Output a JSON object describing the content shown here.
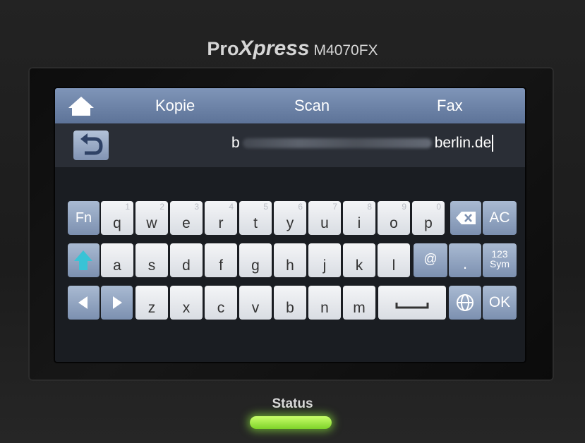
{
  "device": {
    "brand_pro": "Pro",
    "brand_x": "Xpress",
    "model": "M4070FX"
  },
  "topbar": {
    "home_icon": "home-icon",
    "tabs": [
      "Kopie",
      "Scan",
      "Fax"
    ]
  },
  "input": {
    "back_icon": "back-arrow-icon",
    "prefix": "b",
    "suffix": "berlin.de"
  },
  "keyboard": {
    "row1": [
      {
        "label": "q",
        "sub": "1"
      },
      {
        "label": "w",
        "sub": "2"
      },
      {
        "label": "e",
        "sub": "3"
      },
      {
        "label": "r",
        "sub": "4"
      },
      {
        "label": "t",
        "sub": "5"
      },
      {
        "label": "y",
        "sub": "6"
      },
      {
        "label": "u",
        "sub": "7"
      },
      {
        "label": "i",
        "sub": "8"
      },
      {
        "label": "o",
        "sub": "9"
      },
      {
        "label": "p",
        "sub": "0"
      }
    ],
    "row2": [
      "a",
      "s",
      "d",
      "f",
      "g",
      "h",
      "j",
      "k",
      "l"
    ],
    "row3": [
      "z",
      "x",
      "c",
      "v",
      "b",
      "n",
      "m"
    ],
    "fn": "Fn",
    "ac": "AC",
    "at": "@",
    "dot": ".",
    "sym_top": "123",
    "sym_bottom": "Sym",
    "ok": "OK",
    "backspace_icon": "backspace-icon",
    "shift_icon": "shift-arrow-icon",
    "left_icon": "arrow-left-icon",
    "right_icon": "arrow-right-icon",
    "space_icon": "space-icon",
    "globe_icon": "globe-icon"
  },
  "status": {
    "label": "Status",
    "led_color": "#8ee43a"
  }
}
